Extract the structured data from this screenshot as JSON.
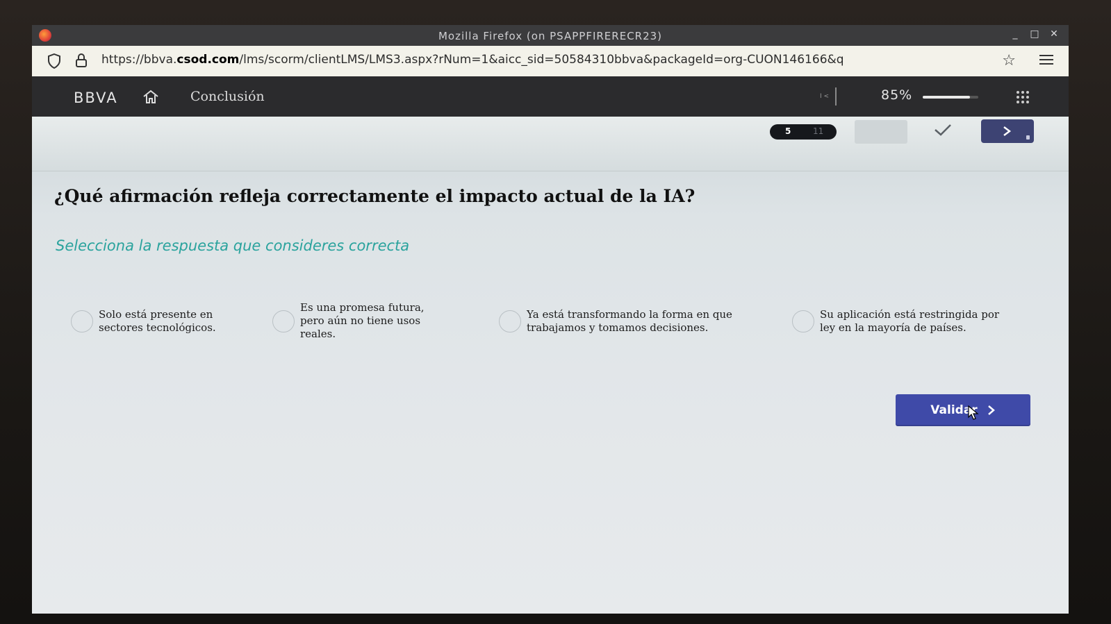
{
  "window": {
    "title": "Mozilla Firefox (on PSAPPFIRERECR23)",
    "controls": [
      "_",
      "□",
      "✕"
    ]
  },
  "urlbar": {
    "url_prefix": "https://bbva.",
    "url_domain": "csod.com",
    "url_rest": "/lms/scorm/clientLMS/LMS3.aspx?rNum=1&aicc_sid=50584310bbva&packageId=org-CUON146166&q"
  },
  "header": {
    "brand": "BBVA",
    "section": "Conclusión",
    "mini_label": "I <",
    "progress_label": "85%",
    "progress_value": 0.85
  },
  "nav": {
    "current_page": "5",
    "total_pages": "11"
  },
  "quiz": {
    "question": "¿Qué afirmación refleja correctamente el impacto actual de la IA?",
    "instruction": "Selecciona la respuesta que consideres correcta",
    "options": [
      {
        "label": "Solo está presente en sectores tecnológicos."
      },
      {
        "label": "Es una promesa futura, pero aún no tiene usos reales."
      },
      {
        "label": "Ya está transformando la forma en que trabajamos y tomamos decisiones."
      },
      {
        "label": "Su aplicación está restringida por ley en la mayoría de países."
      }
    ],
    "validate_label": "Validar"
  },
  "colors": {
    "accent": "#3f4aa8",
    "instruction": "#2aa39d",
    "header_bg": "#2b2b2d"
  }
}
